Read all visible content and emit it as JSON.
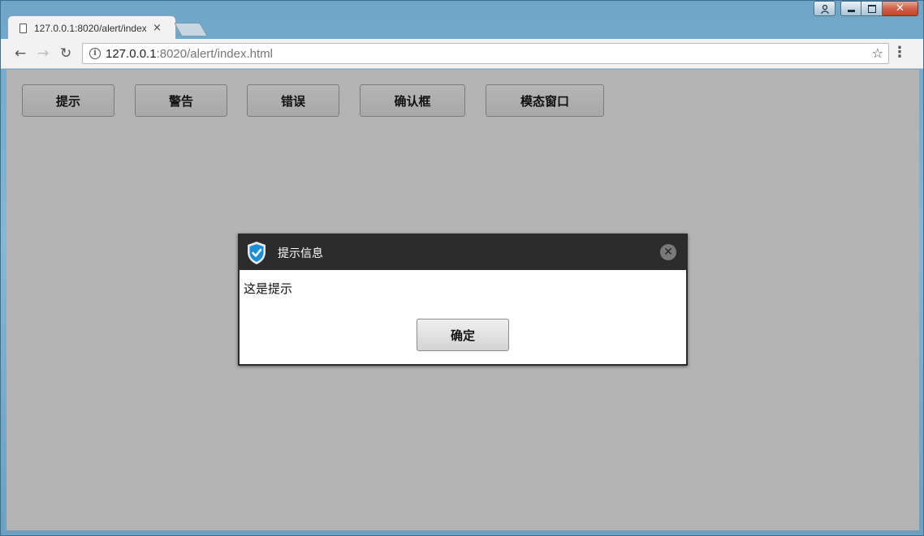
{
  "browser": {
    "tab_title": "127.0.0.1:8020/alert/index.html",
    "tab_close": "×",
    "url_host": "127.0.0.1",
    "url_rest": ":8020/alert/index.html",
    "icons": {
      "back": "←",
      "forward": "→",
      "reload": "↻",
      "info": "i",
      "star": "☆",
      "menu": "⋮",
      "minimize": "▁",
      "maximize": "▢",
      "close": "✕",
      "profile": "👤"
    }
  },
  "page": {
    "buttons": [
      {
        "label": "提示"
      },
      {
        "label": "警告"
      },
      {
        "label": "错误"
      },
      {
        "label": "确认框"
      },
      {
        "label": "模态窗口"
      }
    ]
  },
  "dialog": {
    "title": "提示信息",
    "message": "这是提示",
    "ok_label": "确定",
    "close_glyph": "✕",
    "colors": {
      "header": "#2c2c2c",
      "shield": "#1b8fd6"
    }
  }
}
